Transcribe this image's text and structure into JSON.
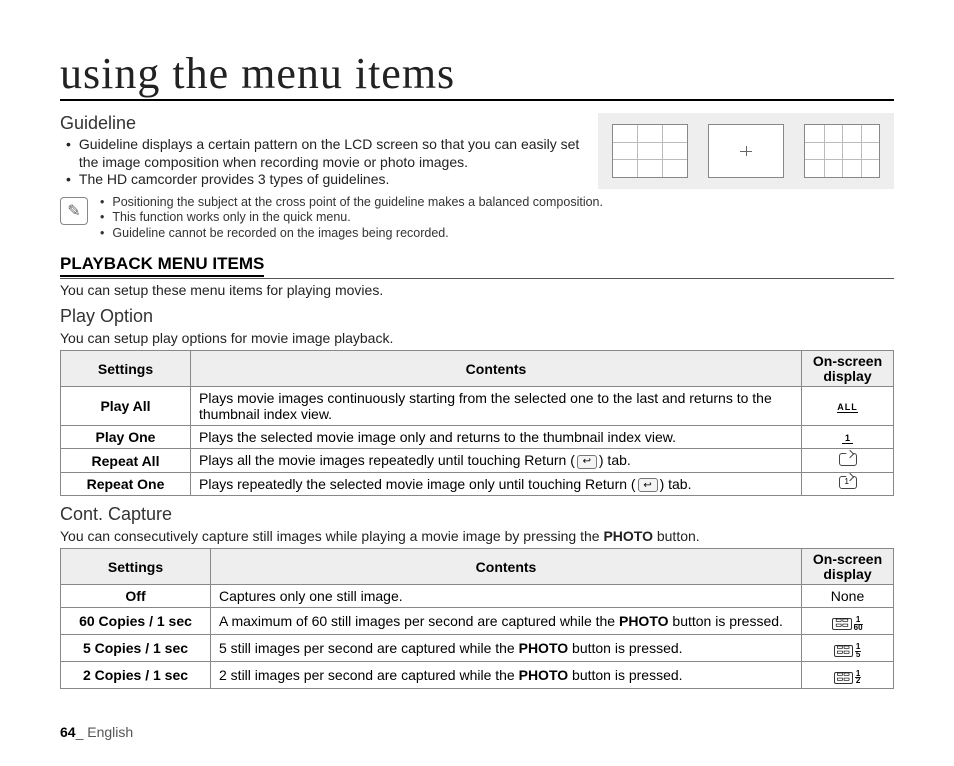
{
  "page_title": "using the menu items",
  "guideline": {
    "heading": "Guideline",
    "bullets": [
      "Guideline displays a certain pattern on the LCD screen so that you can easily set the image composition when recording movie or photo images.",
      "The HD camcorder provides 3 types of guidelines."
    ],
    "notes": [
      "Positioning the subject at the cross point of the guideline makes a balanced composition.",
      "This function works only in the quick menu.",
      "Guideline cannot be recorded on the images being recorded."
    ]
  },
  "playback": {
    "heading": "PLAYBACK MENU ITEMS",
    "intro": "You can setup these menu items for playing movies."
  },
  "play_option": {
    "heading": "Play Option",
    "intro": "You can setup play options for movie image playback.",
    "headers": {
      "settings": "Settings",
      "contents": "Contents",
      "osd": "On-screen display"
    },
    "rows": [
      {
        "setting": "Play All",
        "content": "Plays movie images continuously starting from the selected one to the last and returns to the thumbnail index view.",
        "icon": "all"
      },
      {
        "setting": "Play One",
        "content": "Plays the selected movie image only and returns to the thumbnail index view.",
        "icon": "one"
      },
      {
        "setting": "Repeat All",
        "content_pre": "Plays all the movie images repeatedly until touching Return (",
        "content_post": ") tab.",
        "icon": "repeat-all"
      },
      {
        "setting": "Repeat One",
        "content_pre": "Plays repeatedly the selected movie image only until touching Return (",
        "content_post": ") tab.",
        "icon": "repeat-one"
      }
    ]
  },
  "cont_capture": {
    "heading": "Cont. Capture",
    "intro_pre": "You can consecutively capture still images while playing a movie image by pressing the ",
    "intro_bold": "PHOTO",
    "intro_post": " button.",
    "headers": {
      "settings": "Settings",
      "contents": "Contents",
      "osd": "On-screen display"
    },
    "rows": [
      {
        "setting": "Off",
        "content": "Captures only one still image.",
        "osd_text": "None"
      },
      {
        "setting": "60 Copies / 1 sec",
        "content_pre": "A maximum of 60 still images per second are captured while the ",
        "bold": "PHOTO",
        "content_post": " button is pressed.",
        "frac": "1/60"
      },
      {
        "setting": "5 Copies / 1 sec",
        "content_pre": "5 still images per second are captured while the ",
        "bold": "PHOTO",
        "content_post": " button is pressed.",
        "frac": "1/5"
      },
      {
        "setting": "2 Copies / 1 sec",
        "content_pre": "2 still images per second are captured while the ",
        "bold": "PHOTO",
        "content_post": " button is pressed.",
        "frac": "1/2"
      }
    ]
  },
  "footer": {
    "page": "64",
    "sep": "_ ",
    "lang": "English"
  }
}
